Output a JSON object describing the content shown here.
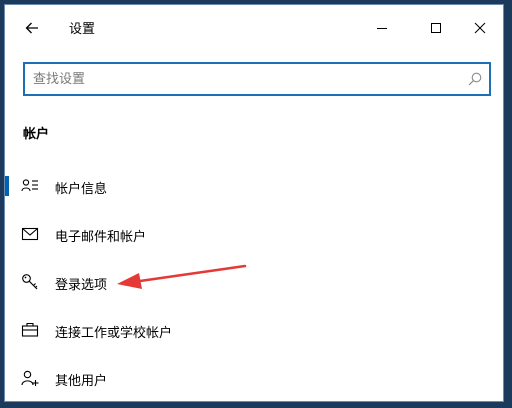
{
  "window": {
    "title": "设置"
  },
  "search": {
    "placeholder": "查找设置"
  },
  "section": {
    "title": "帐户"
  },
  "nav": {
    "items": [
      {
        "label": "帐户信息",
        "icon": "person-list-icon"
      },
      {
        "label": "电子邮件和帐户",
        "icon": "mail-icon"
      },
      {
        "label": "登录选项",
        "icon": "key-icon"
      },
      {
        "label": "连接工作或学校帐户",
        "icon": "briefcase-icon"
      },
      {
        "label": "其他用户",
        "icon": "person-add-icon"
      }
    ]
  },
  "colors": {
    "accent": "#0063b1",
    "search_border": "#1e6fb8",
    "annotation_arrow": "#e53935",
    "desktop": "#1b3a5c"
  }
}
